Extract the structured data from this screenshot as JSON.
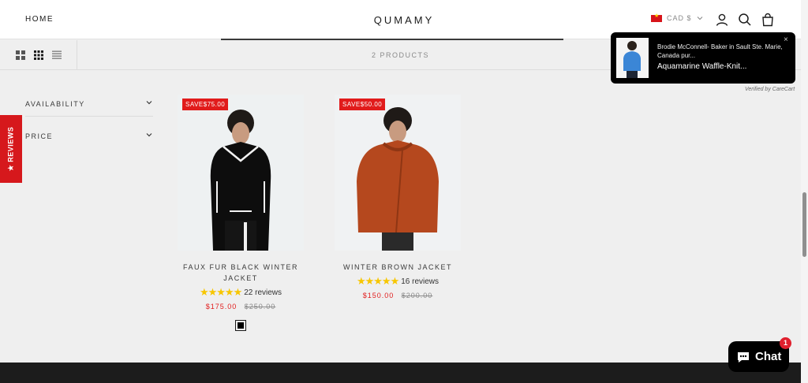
{
  "header": {
    "nav_home": "HOME",
    "brand": "QUMAMY",
    "currency": "CAD $",
    "icons": [
      "account-icon",
      "search-icon",
      "bag-icon"
    ]
  },
  "toolbar": {
    "product_count": "2 PRODUCTS",
    "view_icons": [
      "grid-large-icon",
      "grid-small-icon",
      "list-view-icon"
    ]
  },
  "filters": [
    {
      "label": "AVAILABILITY"
    },
    {
      "label": "PRICE"
    }
  ],
  "reviews_tab": {
    "label": "★ REVIEWS"
  },
  "products": [
    {
      "badge": "SAVE$75.00",
      "title": "FAUX FUR BLACK WINTER JACKET",
      "stars": "★★★★★",
      "rating_value": 5,
      "reviews": "22 reviews",
      "price": "$175.00",
      "compare_price": "$250.00",
      "swatch_color": "#000000"
    },
    {
      "badge": "SAVE$50.00",
      "title": "WINTER BROWN JACKET",
      "stars": "★★★★★",
      "rating_value": 4.5,
      "reviews": "16 reviews",
      "price": "$150.00",
      "compare_price": "$200.00"
    }
  ],
  "popup": {
    "line1": "Brodie McConnell- Baker in Sault Ste. Marie, Canada pur...",
    "line2": "Aquamarine Waffle-Knit...",
    "close": "×"
  },
  "verified": "Verified by CareCart",
  "chat": {
    "label": "Chat",
    "badge": "1"
  },
  "colors": {
    "accent_red": "#e11b1b",
    "star_gold": "#f7c600",
    "footer": "#1c1c1c"
  }
}
